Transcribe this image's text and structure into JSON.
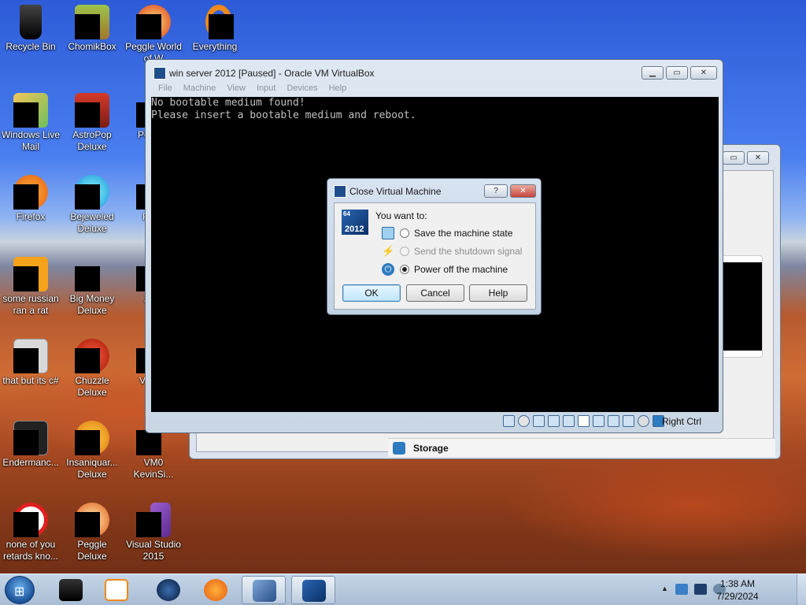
{
  "desktop": {
    "icons": [
      {
        "label": "Recycle Bin",
        "icon": "recycle-bin-icon"
      },
      {
        "label": "ChomikBox",
        "icon": "chomikbox-icon"
      },
      {
        "label": "Peggle World of W",
        "icon": "peggle-world-icon"
      },
      {
        "label": "Everything",
        "icon": "everything-icon"
      },
      {
        "label": "Windows Live Mail",
        "icon": "windows-live-mail-icon"
      },
      {
        "label": "AstroPop Deluxe",
        "icon": "astropop-icon"
      },
      {
        "label": "Pegg D",
        "icon": "peggle-icon"
      },
      {
        "label": "Firefox",
        "icon": "firefox-icon"
      },
      {
        "label": "Bejeweled Deluxe",
        "icon": "bejeweled-icon"
      },
      {
        "label": "Pl Ze",
        "icon": "plants-zombies-icon"
      },
      {
        "label": "some russian ran a rat",
        "icon": "notepad-file-icon"
      },
      {
        "label": "Big Money Deluxe",
        "icon": "big-money-icon"
      },
      {
        "label": "Zum",
        "icon": "zuma-icon"
      },
      {
        "label": "that but its c#",
        "icon": "file-stack-icon"
      },
      {
        "label": "Chuzzle Deluxe",
        "icon": "chuzzle-icon"
      },
      {
        "label": "VM Ke",
        "icon": "vm-shortcut-icon"
      },
      {
        "label": "Endermanc...",
        "icon": "console-icon"
      },
      {
        "label": "Insaniquar... Deluxe",
        "icon": "insaniquarium-icon"
      },
      {
        "label": "VM0 KevinSi...",
        "icon": "vm0-icon"
      },
      {
        "label": "none of you retards kno...",
        "icon": "red-circle-icon"
      },
      {
        "label": "Peggle Deluxe",
        "icon": "peggle-deluxe-icon"
      },
      {
        "label": "Visual Studio 2015",
        "icon": "visual-studio-icon"
      }
    ]
  },
  "vm_window": {
    "title": "win server 2012 [Paused] - Oracle VM VirtualBox",
    "menu": [
      "File",
      "Machine",
      "View",
      "Input",
      "Devices",
      "Help"
    ],
    "screen_text": "No bootable medium found!\nPlease insert a bootable medium and reboot.",
    "host_key": "Right Ctrl"
  },
  "bg_window": {
    "storage_label": "Storage"
  },
  "dialog": {
    "title": "Close Virtual Machine",
    "logo_arch": "64",
    "logo_year": "2012",
    "prompt": "You want to:",
    "options": [
      {
        "label": "Save the machine state",
        "enabled": true,
        "selected": false
      },
      {
        "label": "Send the shutdown signal",
        "enabled": false,
        "selected": false
      },
      {
        "label": "Power off the machine",
        "enabled": true,
        "selected": true
      }
    ],
    "buttons": {
      "ok": "OK",
      "cancel": "Cancel",
      "help": "Help"
    },
    "help_btn": "?",
    "close_btn": "✕"
  },
  "taskbar": {
    "items": [
      "VirtualBox-dark",
      "Media Player",
      "Globe",
      "Firefox",
      "VirtualBox",
      "win server 2012"
    ],
    "clock_time": "1:38 AM",
    "clock_date": "7/29/2024",
    "tray_arrow": "▲"
  },
  "colors": {
    "accent": "#3c7fb1",
    "vbox_blue": "#1f4f8a"
  }
}
